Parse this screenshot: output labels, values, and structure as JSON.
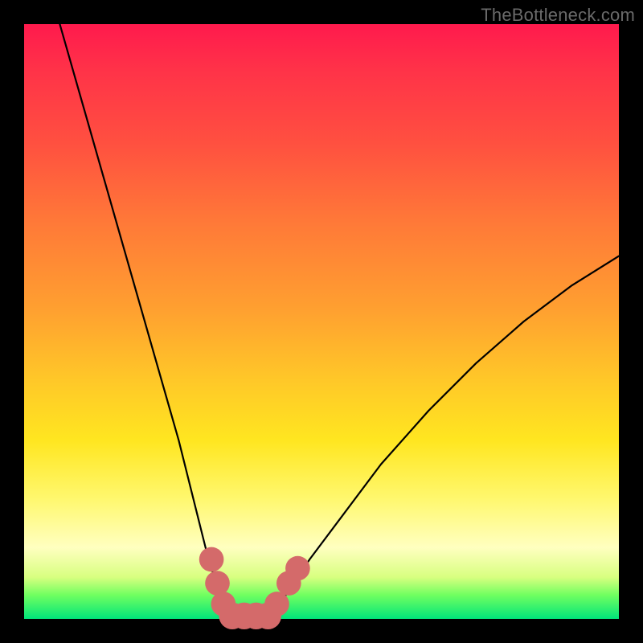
{
  "attribution": "TheBottleneck.com",
  "colors": {
    "frame": "#000000",
    "gradient_top": "#ff1a4d",
    "gradient_mid_orange": "#ff7838",
    "gradient_yellow": "#ffe620",
    "gradient_pale": "#ffffc0",
    "gradient_green": "#00e57a",
    "curve": "#000000",
    "marker_fill": "#d46a6a",
    "marker_stroke": "#d46a6a"
  },
  "chart_data": {
    "type": "line",
    "title": "",
    "xlabel": "",
    "ylabel": "",
    "xlim": [
      0,
      100
    ],
    "ylim": [
      0,
      100
    ],
    "grid": false,
    "legend": false,
    "series": [
      {
        "name": "left-branch",
        "x": [
          6,
          10,
          14,
          18,
          22,
          26,
          29,
          31,
          33,
          34,
          35
        ],
        "y": [
          100,
          86,
          72,
          58,
          44,
          30,
          18,
          10,
          4,
          1,
          0
        ]
      },
      {
        "name": "floor",
        "x": [
          35,
          36,
          37,
          38,
          39,
          40,
          41
        ],
        "y": [
          0,
          0,
          0,
          0,
          0,
          0,
          0
        ]
      },
      {
        "name": "right-branch",
        "x": [
          41,
          44,
          48,
          54,
          60,
          68,
          76,
          84,
          92,
          100
        ],
        "y": [
          0,
          4,
          10,
          18,
          26,
          35,
          43,
          50,
          56,
          61
        ]
      }
    ],
    "markers": [
      {
        "x": 31.5,
        "y": 10,
        "r": 1.4
      },
      {
        "x": 32.5,
        "y": 6,
        "r": 1.4
      },
      {
        "x": 33.5,
        "y": 2.5,
        "r": 1.4
      },
      {
        "x": 35.0,
        "y": 0.5,
        "r": 1.6
      },
      {
        "x": 37.0,
        "y": 0.5,
        "r": 1.6
      },
      {
        "x": 39.0,
        "y": 0.5,
        "r": 1.6
      },
      {
        "x": 41.0,
        "y": 0.5,
        "r": 1.6
      },
      {
        "x": 42.5,
        "y": 2.5,
        "r": 1.4
      },
      {
        "x": 44.5,
        "y": 6,
        "r": 1.4
      },
      {
        "x": 46.0,
        "y": 8.5,
        "r": 1.4
      }
    ],
    "notes": "x and y are percentages of the plot area (0–100). y=0 is the bottom edge (green), y=100 is the top edge."
  }
}
